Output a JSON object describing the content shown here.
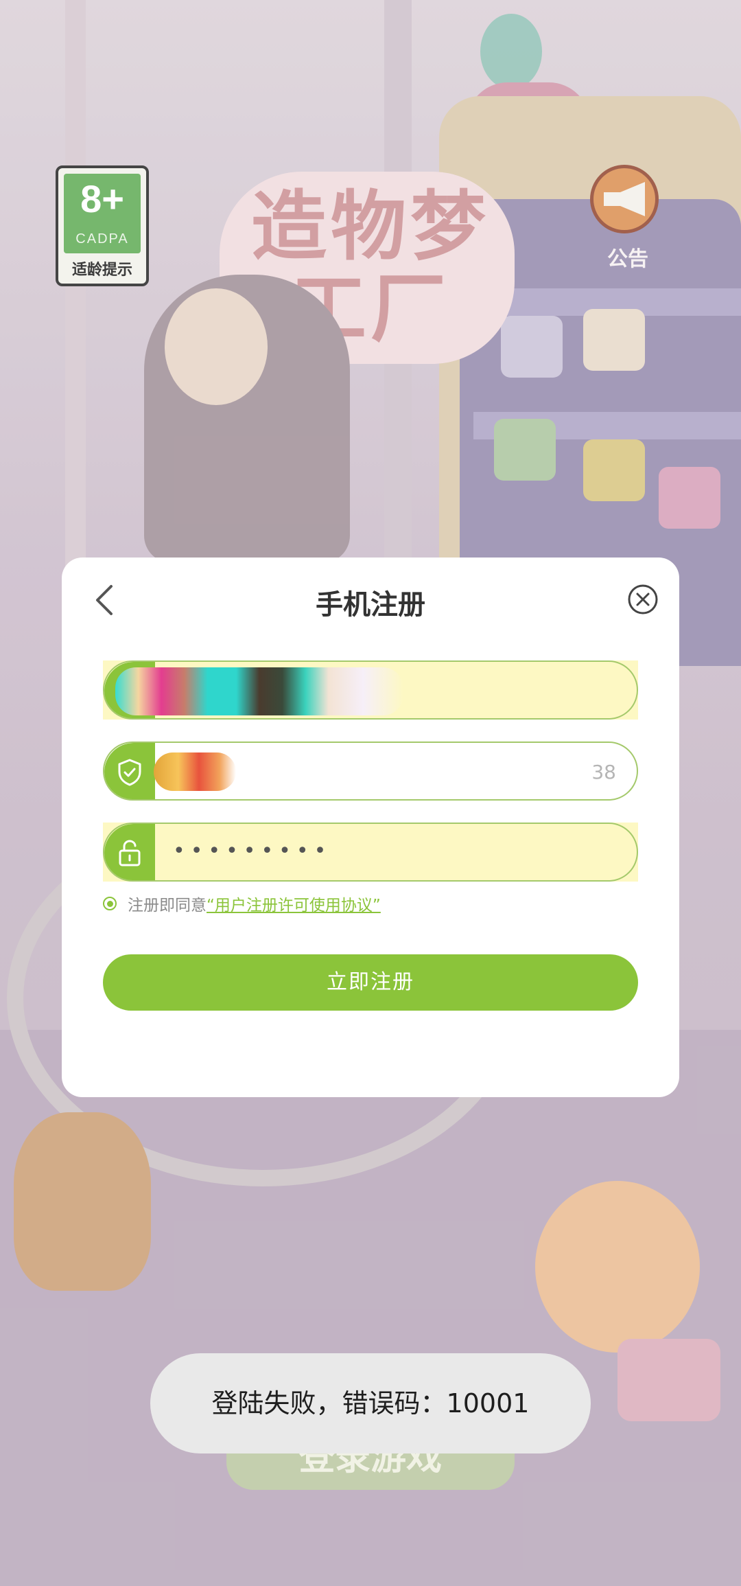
{
  "background": {
    "game_title": "造物梦工厂",
    "login_button_label": "登录游戏"
  },
  "age_badge": {
    "rating": "8+",
    "org": "CADPA",
    "tip": "适龄提示"
  },
  "notice": {
    "label": "公告",
    "icon": "megaphone-icon"
  },
  "dialog": {
    "title": "手机注册",
    "back_icon": "chevron-left-icon",
    "close_icon": "close-circle-icon",
    "phone_field": {
      "icon": "phone-icon",
      "redacted": true
    },
    "code_field": {
      "icon": "shield-check-icon",
      "redacted": true,
      "countdown": "38"
    },
    "password_field": {
      "icon": "unlock-icon",
      "value": "•••••••••"
    },
    "agreement": {
      "prefix": "注册即同意",
      "link": "“用户注册许可使用协议”"
    },
    "submit_label": "立即注册"
  },
  "toast": {
    "message": "登陆失败，错误码：10001"
  },
  "colors": {
    "accent": "#8bc43a",
    "highlight": "#fdf8c3",
    "toast_bg": "#e9e9e9"
  }
}
